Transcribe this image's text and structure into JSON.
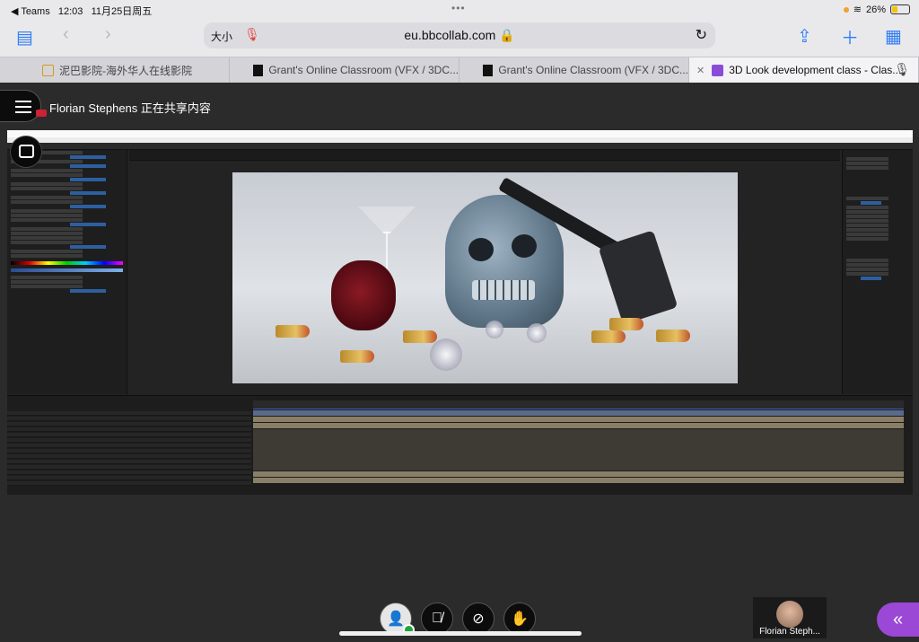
{
  "status_bar": {
    "back_app": "◀ Teams",
    "time": "12:03",
    "date": "11月25日周五",
    "battery": "26%"
  },
  "safari": {
    "text_size": "大小",
    "url": "eu.bbcollab.com 🔒"
  },
  "tabs": [
    {
      "label": "泥巴影院-海外华人在线影院",
      "active": false
    },
    {
      "label": "Grant's Online Classroom (VFX / 3DC...",
      "active": false
    },
    {
      "label": "Grant's Online Classroom (VFX / 3DC...",
      "active": false
    },
    {
      "label": "3D Look development class - Clas...",
      "active": true
    }
  ],
  "session": {
    "sharer_text": "Florian Stephens 正在共享内容"
  },
  "participant": {
    "name": "Florian Steph..."
  },
  "colors": {
    "accent": "#9b48d6",
    "safari_blue": "#2f7cf6",
    "status_ok": "#1fa33a"
  }
}
